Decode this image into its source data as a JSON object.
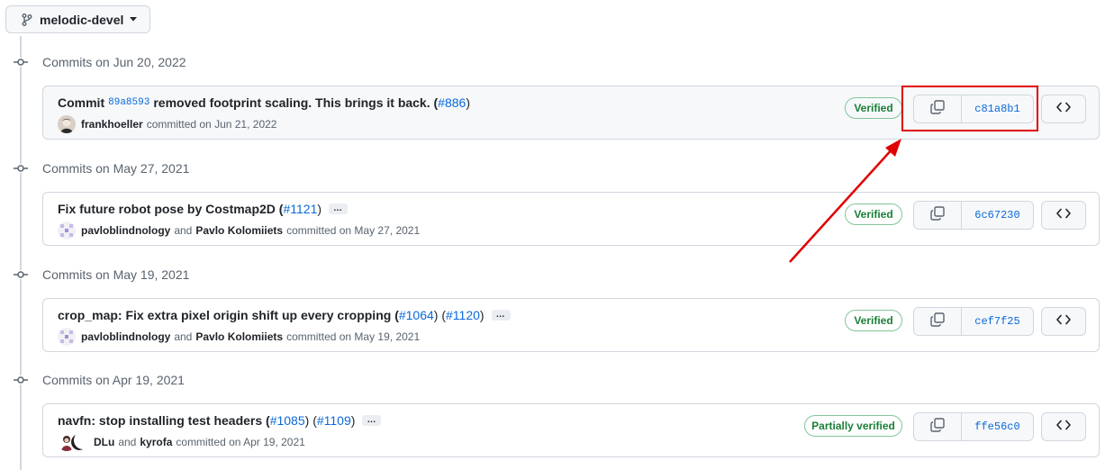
{
  "branch": {
    "name": "melodic-devel"
  },
  "groups": [
    {
      "date_label": "Commits on Jun 20, 2022",
      "commit": {
        "message_prefix": "Commit",
        "inline_sha": "89a8593",
        "message_rest": "removed footprint scaling. This brings it back. (",
        "issue": "#886",
        "close": ")",
        "authors": [
          "frankhoeller"
        ],
        "joiner": "",
        "action": "committed on Jun 21, 2022",
        "badge": "Verified",
        "sha": "c81a8b1"
      }
    },
    {
      "date_label": "Commits on May 27, 2021",
      "commit": {
        "message": "Fix future robot pose by Costmap2D (",
        "issue": "#1121",
        "close": ")",
        "ellipsis": "…",
        "authors": [
          "pavloblindnology",
          "Pavlo Kolomiiets"
        ],
        "joiner": "and",
        "action": "committed on May 27, 2021",
        "badge": "Verified",
        "sha": "6c67230"
      }
    },
    {
      "date_label": "Commits on May 19, 2021",
      "commit": {
        "message": "crop_map: Fix extra pixel origin shift up every cropping (",
        "issue": "#1064",
        "mid": ") (",
        "issue2": "#1120",
        "close": ")",
        "ellipsis": "…",
        "authors": [
          "pavloblindnology",
          "Pavlo Kolomiiets"
        ],
        "joiner": "and",
        "action": "committed on May 19, 2021",
        "badge": "Verified",
        "sha": "cef7f25"
      }
    },
    {
      "date_label": "Commits on Apr 19, 2021",
      "commit": {
        "message": "navfn: stop installing test headers (",
        "issue": "#1085",
        "mid": ") (",
        "issue2": "#1109",
        "close": ")",
        "ellipsis": "…",
        "authors": [
          "DLu",
          "kyrofa"
        ],
        "joiner": "and",
        "action": "committed on Apr 19, 2021",
        "badge": "Partially verified",
        "sha": "ffe56c0"
      }
    }
  ],
  "icons": {
    "branch": "git-branch-icon",
    "caret": "triangle-down-icon",
    "commit_node": "git-commit-icon",
    "copy": "copy-icon",
    "browse": "code-icon"
  },
  "colors": {
    "link": "#0969da",
    "verified_text": "#1a7f37",
    "verified_border": "#82c596",
    "annotation": "#e00000"
  }
}
